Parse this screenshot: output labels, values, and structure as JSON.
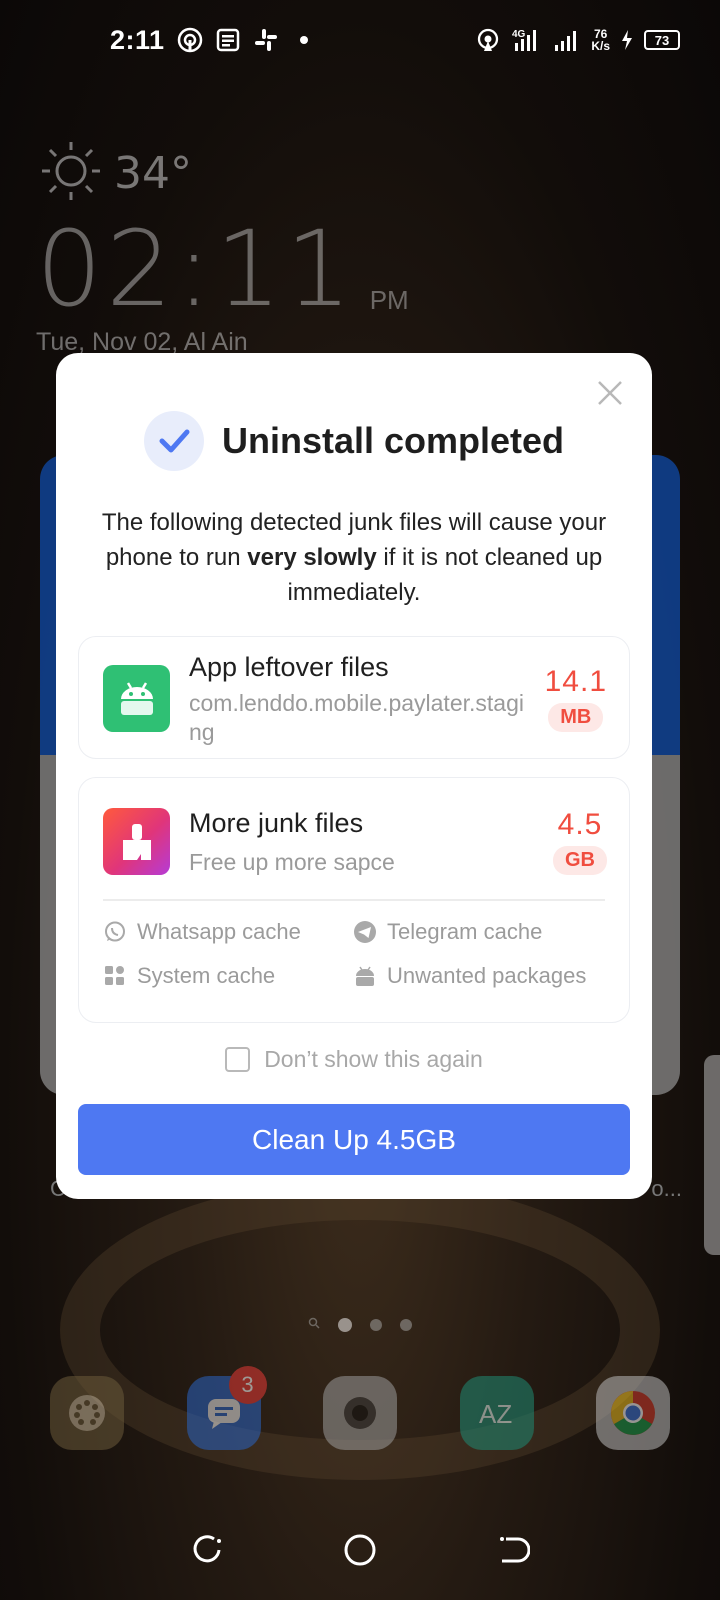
{
  "status_bar": {
    "time": "2:11",
    "network_type": "4G",
    "net_speed_value": "76",
    "net_speed_unit": "K/s",
    "battery": "73"
  },
  "lockscreen": {
    "temperature": "34°",
    "clock": "02:11",
    "ampm": "PM",
    "date_location": "Tue, Nov 02, Al Ain"
  },
  "background": {
    "label_left": "C",
    "label_right": "o...",
    "dock_badge": "3"
  },
  "dialog": {
    "title": "Uninstall completed",
    "description_before": "The following detected junk files will cause your phone to run ",
    "description_bold": "very slowly",
    "description_after": " if it is not cleaned up immediately.",
    "app_leftover": {
      "title": "App leftover files",
      "package": "com.lenddo.mobile.paylater.staging",
      "size_value": "14.1",
      "size_unit": "MB"
    },
    "more_junk": {
      "title": "More junk files",
      "subtitle": "Free up more sapce",
      "size_value": "4.5",
      "size_unit": "GB",
      "items": [
        {
          "label": "Whatsapp cache",
          "icon": "whatsapp-icon"
        },
        {
          "label": "Telegram cache",
          "icon": "telegram-icon"
        },
        {
          "label": "System cache",
          "icon": "system-grid-icon"
        },
        {
          "label": "Unwanted packages",
          "icon": "android-icon"
        }
      ]
    },
    "dont_show_label": "Don’t show this again",
    "cta_label": "Clean Up 4.5GB"
  },
  "colors": {
    "accent": "#4e78f2",
    "danger": "#f04d3f",
    "success_icon_bg": "#2fc074"
  }
}
